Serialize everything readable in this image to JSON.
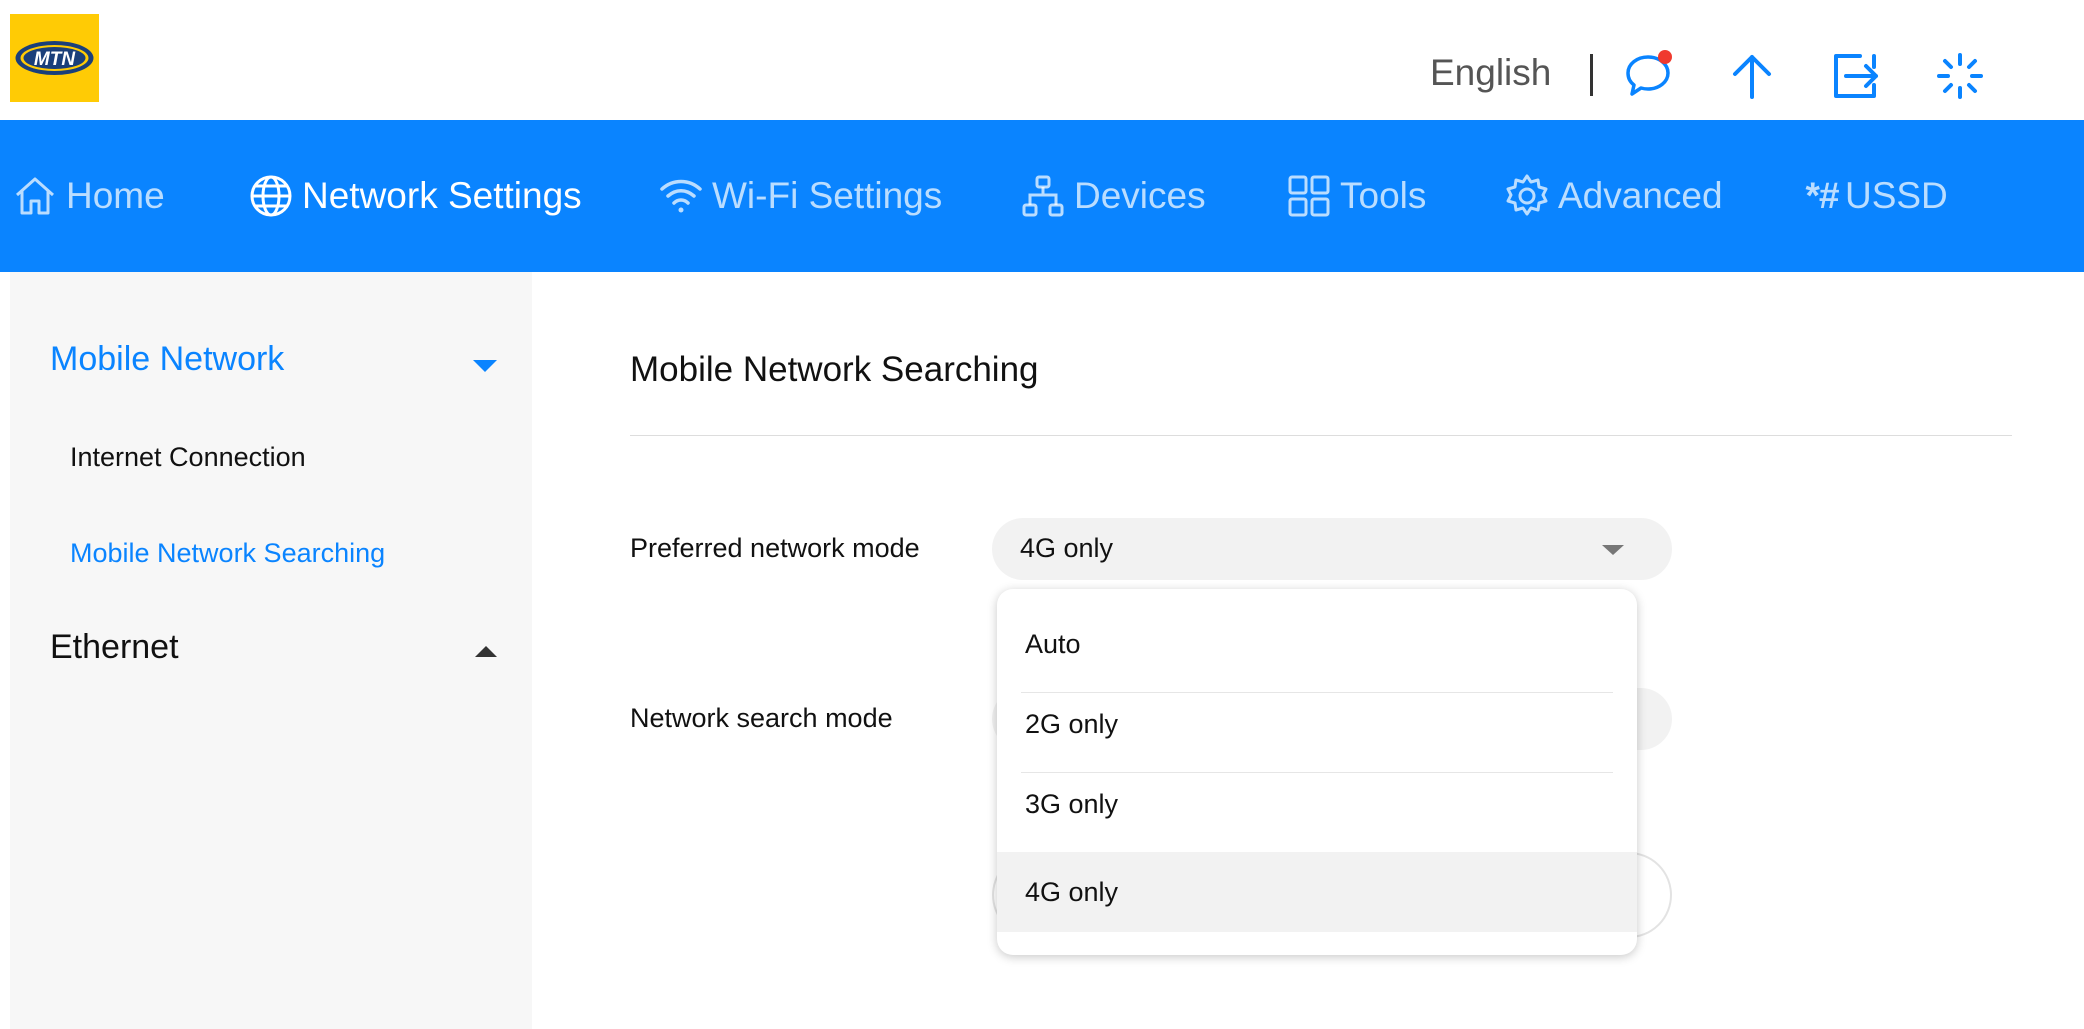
{
  "brand": {
    "logo_text": "MTN",
    "accent": "#0a84ff",
    "logo_bg": "#ffcb05"
  },
  "header": {
    "language": "English",
    "icons": [
      "message-icon",
      "upload-icon",
      "logout-icon",
      "loading-icon"
    ]
  },
  "nav": {
    "items": [
      {
        "label": "Home",
        "icon": "home-icon"
      },
      {
        "label": "Network Settings",
        "icon": "globe-icon"
      },
      {
        "label": "Wi-Fi Settings",
        "icon": "wifi-icon"
      },
      {
        "label": "Devices",
        "icon": "devices-icon"
      },
      {
        "label": "Tools",
        "icon": "tools-icon"
      },
      {
        "label": "Advanced",
        "icon": "gear-icon"
      },
      {
        "label": "USSD",
        "symbol": "*#"
      }
    ],
    "active": "Network Settings"
  },
  "sidebar": {
    "groups": [
      {
        "label": "Mobile Network",
        "expanded": true,
        "items": [
          "Internet Connection",
          "Mobile Network Searching"
        ]
      },
      {
        "label": "Ethernet",
        "expanded": false
      }
    ],
    "active_item": "Mobile Network Searching"
  },
  "main": {
    "title": "Mobile Network Searching",
    "preferred_mode_label": "Preferred network mode",
    "preferred_mode_value": "4G only",
    "search_mode_label": "Network search mode",
    "dropdown_options": [
      "Auto",
      "2G only",
      "3G only",
      "4G only"
    ],
    "dropdown_selected": "4G only"
  }
}
